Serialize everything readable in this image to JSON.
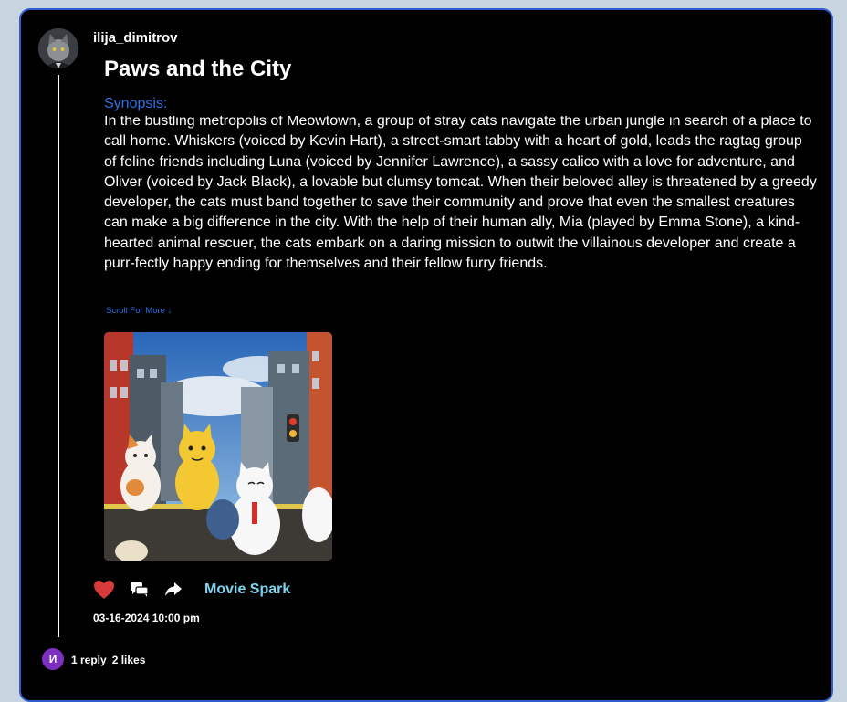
{
  "post": {
    "username": "ilija_dimitrov",
    "title": "Paws and the City",
    "synopsis_label": "Synopsis:",
    "synopsis": "In the bustling metropolis of Meowtown, a group of stray cats navigate the urban jungle in search of a place to call home. Whiskers (voiced by Kevin Hart), a street-smart tabby with a heart of gold, leads the ragtag group of feline friends including Luna (voiced by Jennifer Lawrence), a sassy calico with a love for adventure, and Oliver (voiced by Jack Black), a lovable but clumsy tomcat. When their beloved alley is threatened by a greedy developer, the cats must band together to save their community and prove that even the smallest creatures can make a big difference in the city. With the help of their human ally, Mia (played by Emma Stone), a kind-hearted animal rescuer, the cats embark on a daring mission to outwit the villainous developer and create a purr-fectly happy ending for themselves and their fellow furry friends.",
    "scroll_more": "Scroll For More ↓",
    "community": "Movie Spark",
    "timestamp": "03-16-2024 10:00 pm"
  },
  "footer": {
    "avatar_initial": "И",
    "replies": "1 reply",
    "likes": "2 likes"
  },
  "icons": {
    "like": "heart-icon",
    "comment": "chat-bubbles-icon",
    "share": "share-arrow-icon"
  },
  "colors": {
    "background": "#c8d4e0",
    "card": "#000000",
    "card_border": "#2d5ecf",
    "accent_blue": "#2f6fe6",
    "community": "#7dd6f0",
    "heart": "#d63a3a",
    "avatar_bg": "#7d2fbf"
  }
}
